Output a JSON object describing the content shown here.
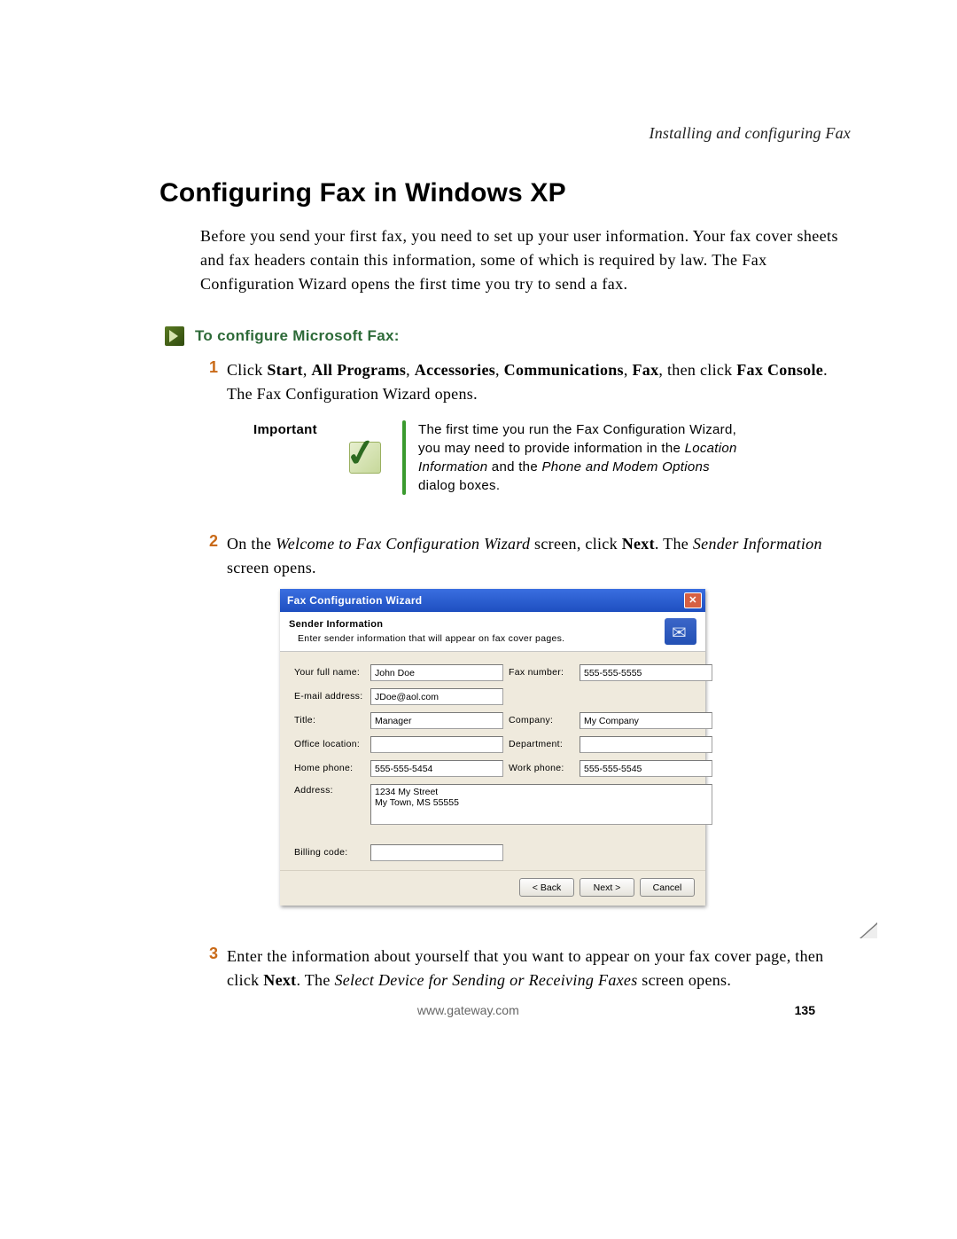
{
  "running_head": "Installing and configuring Fax",
  "page_title": "Configuring Fax in Windows XP",
  "intro": "Before you send your first fax, you need to set up your user information. Your fax cover sheets and fax headers contain this information, some of which is required by law. The Fax Configuration Wizard opens the first time you try to send a fax.",
  "procedure_heading": "To configure Microsoft Fax:",
  "steps": {
    "1": {
      "num": "1",
      "pre": "Click ",
      "b1": "Start",
      "c1": ", ",
      "b2": "All Programs",
      "c2": ", ",
      "b3": "Accessories",
      "c3": ", ",
      "b4": "Communications",
      "c4": ", ",
      "b5": "Fax",
      "c5": ", then click ",
      "b6": "Fax Console",
      "post": ". The Fax Configuration Wizard opens."
    },
    "2": {
      "num": "2",
      "pre": "On the ",
      "i1": "Welcome to Fax Configuration Wizard",
      "mid1": " screen, click ",
      "b1": "Next",
      "mid2": ". The ",
      "i2": "Sender Information",
      "post": " screen opens."
    },
    "3": {
      "num": "3",
      "pre": "Enter the information about yourself that you want to appear on your fax cover page, then click ",
      "b1": "Next",
      "mid1": ". The ",
      "i1": "Select Device for Sending or Receiving Faxes",
      "post": " screen opens."
    }
  },
  "callout": {
    "label": "Important",
    "t1": "The first time you run the Fax Configuration Wizard, you may need to provide information in the ",
    "i1": "Location Information",
    "t2": " and the ",
    "i2": "Phone and Modem Options",
    "t3": " dialog boxes."
  },
  "wizard": {
    "title": "Fax Configuration Wizard",
    "header_title": "Sender Information",
    "header_sub": "Enter sender information that will appear on fax cover pages.",
    "labels": {
      "full_name": "Your full name:",
      "fax_number": "Fax number:",
      "email": "E-mail address:",
      "title": "Title:",
      "company": "Company:",
      "office": "Office location:",
      "department": "Department:",
      "home_phone": "Home phone:",
      "work_phone": "Work phone:",
      "address": "Address:",
      "billing": "Billing code:"
    },
    "values": {
      "full_name": "John Doe",
      "fax_number": "555-555-5555",
      "email": "JDoe@aol.com",
      "title": "Manager",
      "company": "My Company",
      "office": "",
      "department": "",
      "home_phone": "555-555-5454",
      "work_phone": "555-555-5545",
      "address": "1234 My Street\nMy Town, MS 55555",
      "billing": ""
    },
    "buttons": {
      "back": "< Back",
      "next": "Next >",
      "cancel": "Cancel"
    }
  },
  "footer": {
    "url": "www.gateway.com",
    "page": "135"
  }
}
